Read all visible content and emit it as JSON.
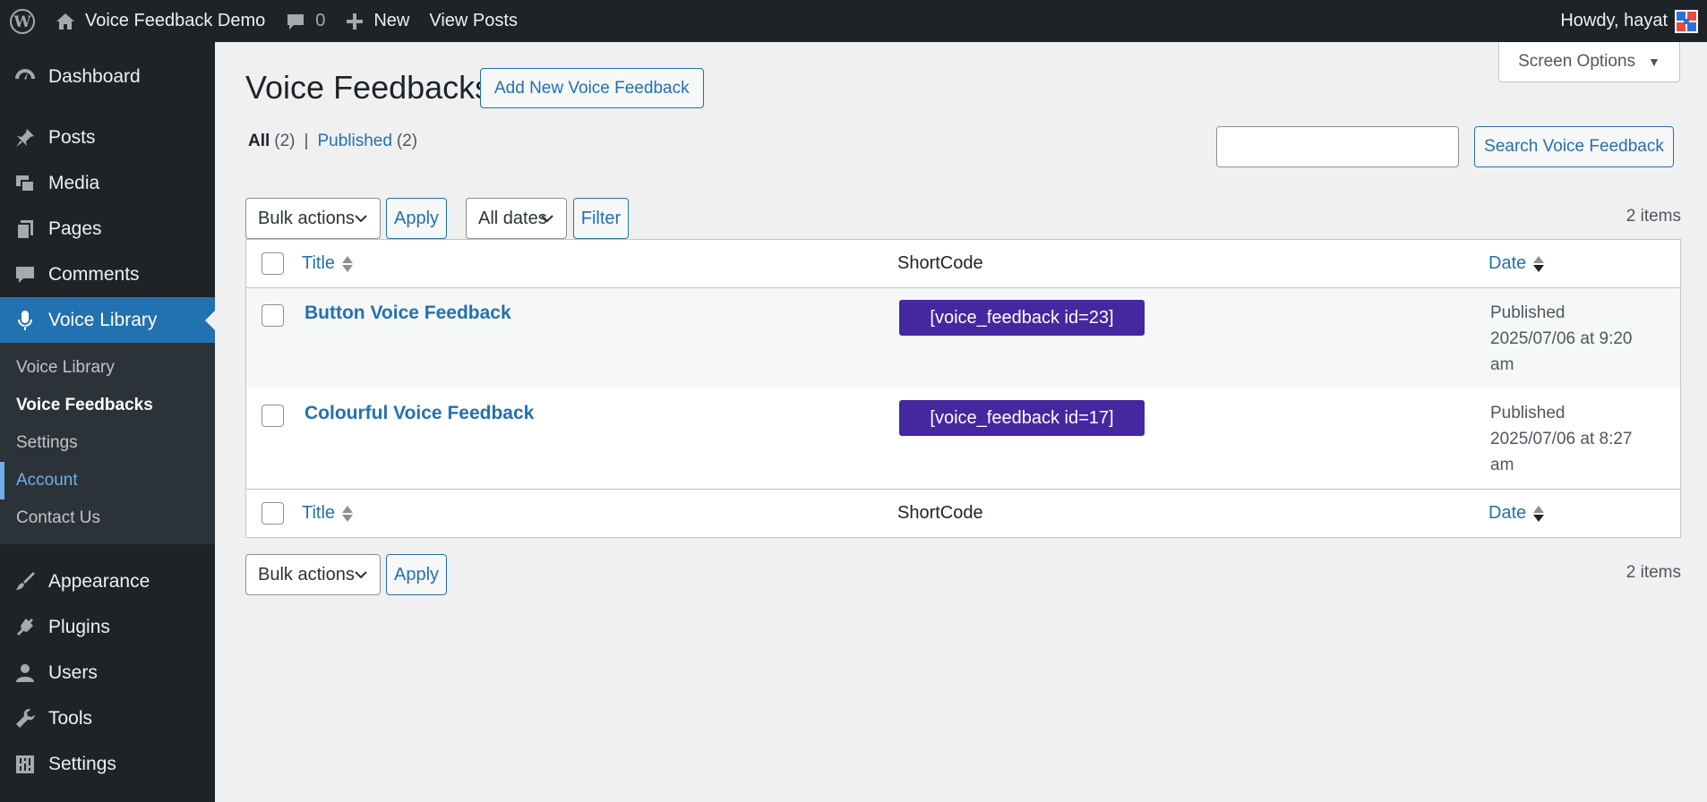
{
  "adminbar": {
    "site_name": "Voice Feedback Demo",
    "comments_count": "0",
    "new_label": "New",
    "view_posts": "View Posts",
    "howdy": "Howdy, hayat"
  },
  "sidebar": {
    "items": [
      {
        "label": "Dashboard",
        "icon": "dashboard-icon"
      },
      {
        "label": "Posts",
        "icon": "pin-icon"
      },
      {
        "label": "Media",
        "icon": "media-icon"
      },
      {
        "label": "Pages",
        "icon": "pages-icon"
      },
      {
        "label": "Comments",
        "icon": "comment-icon"
      },
      {
        "label": "Voice Library",
        "icon": "microphone-icon"
      },
      {
        "label": "Appearance",
        "icon": "brush-icon"
      },
      {
        "label": "Plugins",
        "icon": "plugin-icon"
      },
      {
        "label": "Users",
        "icon": "user-icon"
      },
      {
        "label": "Tools",
        "icon": "wrench-icon"
      },
      {
        "label": "Settings",
        "icon": "settings-icon"
      }
    ],
    "submenu": [
      "Voice Library",
      "Voice Feedbacks",
      "Settings",
      "Account",
      "Contact Us"
    ]
  },
  "header": {
    "screen_options": "Screen Options",
    "title": "Voice Feedbacks",
    "add_new": "Add New Voice Feedback"
  },
  "views": {
    "all_label": "All",
    "all_count": "(2)",
    "separator": "|",
    "published_label": "Published",
    "published_count": "(2)"
  },
  "search": {
    "button": "Search Voice Feedback",
    "value": ""
  },
  "tablenav_top": {
    "bulk": "Bulk actions",
    "apply": "Apply",
    "dates": "All dates",
    "filter": "Filter",
    "count": "2 items"
  },
  "tablenav_bottom": {
    "bulk": "Bulk actions",
    "apply": "Apply",
    "count": "2 items"
  },
  "table": {
    "columns": {
      "title": "Title",
      "shortcode": "ShortCode",
      "date": "Date"
    },
    "rows": [
      {
        "title": "Button Voice Feedback",
        "shortcode": "[voice_feedback id=23]",
        "status": "Published",
        "date": "2025/07/06 at 9:20",
        "time_suffix": "am"
      },
      {
        "title": "Colourful Voice Feedback",
        "shortcode": "[voice_feedback id=17]",
        "status": "Published",
        "date": "2025/07/06 at 8:27",
        "time_suffix": "am"
      }
    ]
  },
  "colors": {
    "accent": "#2271b1",
    "shortcode_bg": "#4527a0",
    "admin_dark": "#1d2327"
  }
}
